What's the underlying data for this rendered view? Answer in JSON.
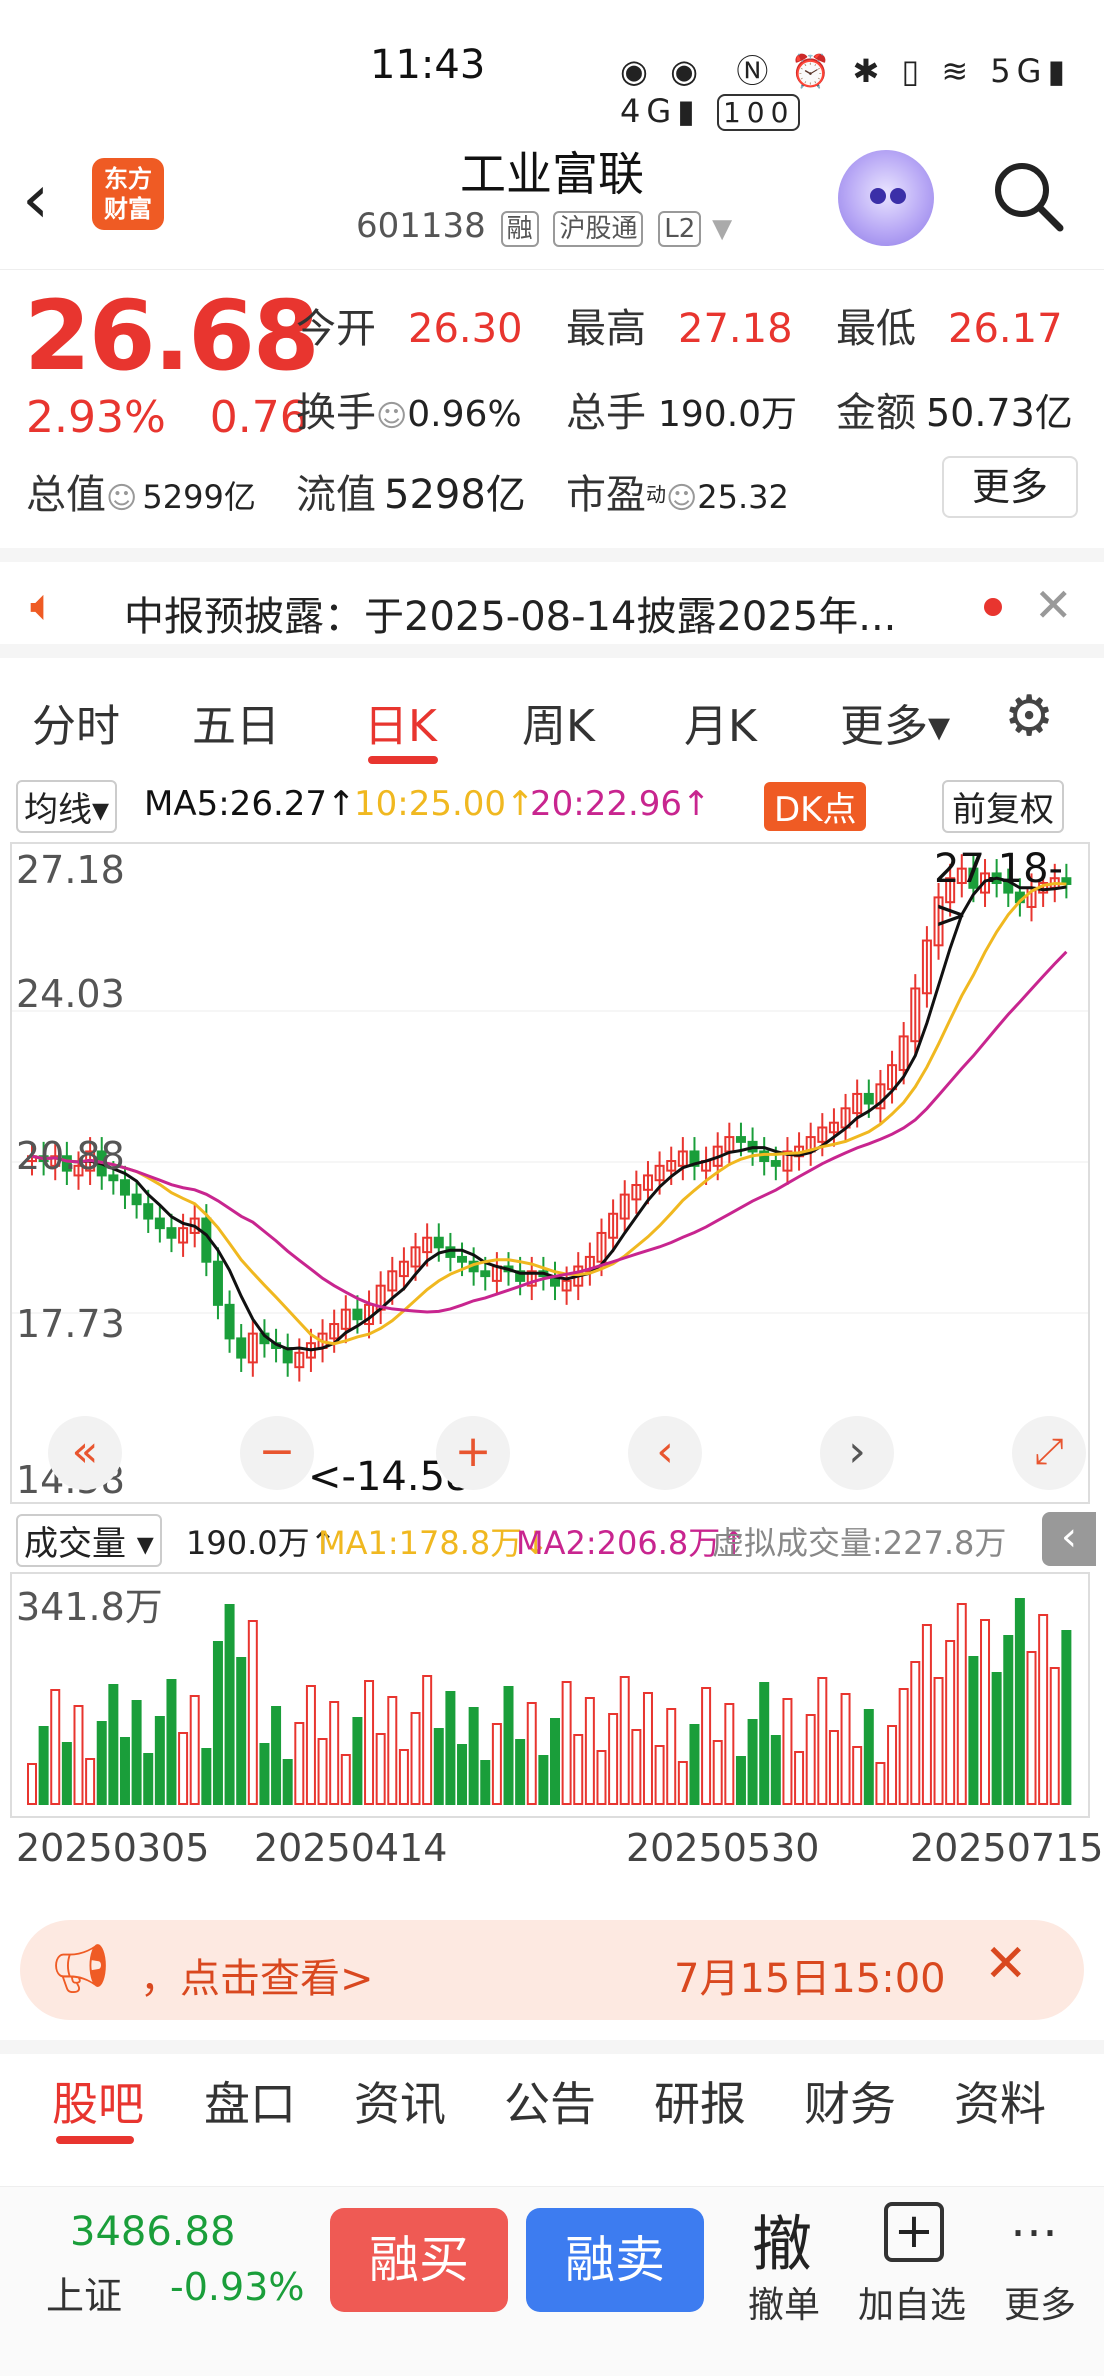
{
  "status_bar": {
    "time": "11:43",
    "battery": "100",
    "network": "5G 4G"
  },
  "header": {
    "stock_name": "工业富联",
    "code": "601138",
    "tags": [
      "融",
      "沪股通",
      "L2"
    ],
    "logo_text_top": "东方",
    "logo_text_bottom": "财富"
  },
  "quote": {
    "price": "26.68",
    "pct": "2.93%",
    "change": "0.76",
    "open_label": "今开",
    "open": "26.30",
    "high_label": "最高",
    "high": "27.18",
    "low_label": "最低",
    "low": "26.17",
    "turnover_label": "换手",
    "turnover": "0.96%",
    "volume_label": "总手",
    "volume": "190.0万",
    "amount_label": "金额",
    "amount": "50.73亿",
    "mktcap_label": "总值",
    "mktcap": "5299亿",
    "float_label": "流值",
    "float": "5298亿",
    "pe_label": "市盈",
    "pe_sup": "动",
    "pe": "25.32",
    "more_label": "更多"
  },
  "notice": {
    "text": "中报预披露：于2025-08-14披露2025年..."
  },
  "period_tabs": [
    "分时",
    "五日",
    "日K",
    "周K",
    "月K",
    "更多▾"
  ],
  "ma": {
    "selector": "均线▾",
    "ma5": "MA5:26.27↑",
    "ma10": "10:25.00↑",
    "ma20": "20:22.96↑",
    "dk_label": "DK点",
    "adjust": "前复权"
  },
  "kchart": {
    "y_labels": [
      "27.18",
      "24.03",
      "20.88",
      "17.73",
      "14.58"
    ],
    "max_label": "27.18->",
    "min_label": "<-14.58",
    "colors": {
      "up": "#e8352f",
      "down": "#1a9e3a",
      "ma5": "#111111",
      "ma10": "#f0b820",
      "ma20": "#c8258f"
    }
  },
  "volume": {
    "selector": "成交量 ▾",
    "value": "190.0万↑",
    "ma1": "MA1:178.8万↓",
    "ma2": "MA2:206.8万↑",
    "virtual": "虚拟成交量:227.8万",
    "y_label": "341.8万",
    "dates": [
      "20250305",
      "20250414",
      "20250530",
      "20250715"
    ]
  },
  "banner": {
    "text_left": "，点击查看>",
    "text_right": "7月15日15:00"
  },
  "bottom_tabs": [
    "股吧",
    "盘口",
    "资讯",
    "公告",
    "研报",
    "财务",
    "资料"
  ],
  "bottom_bar": {
    "index_value": "3486.88",
    "index_name": "上证",
    "index_pct": "-0.93%",
    "buy": "融买",
    "sell": "融卖",
    "cancel_icon": "撤",
    "cancel": "撤单",
    "add": "加自选",
    "more": "更多"
  }
}
